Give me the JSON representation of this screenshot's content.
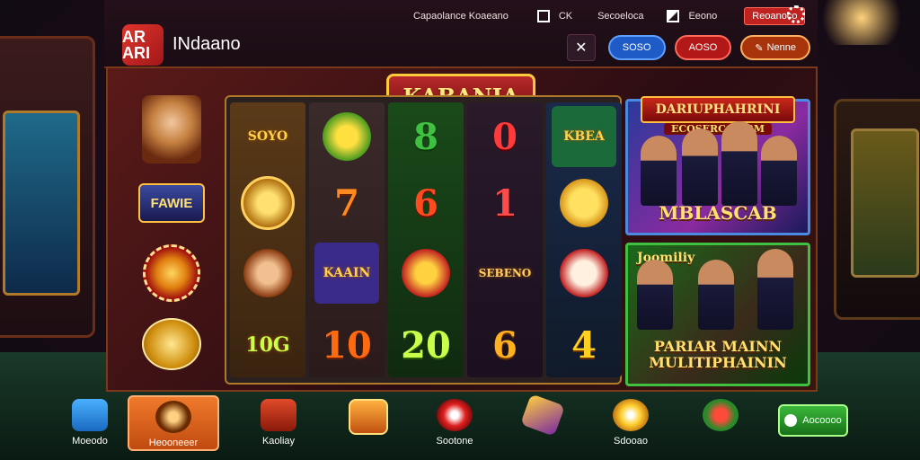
{
  "app": {
    "logo_text": "AR ARI",
    "name": "INdaano"
  },
  "top_links": [
    "Capaolance Koaeano",
    "CK",
    "Secoeloca",
    "Eeono",
    "Reoanoco"
  ],
  "actions": {
    "blue": "SOSO",
    "red": "AOSO",
    "orange": "Nenne"
  },
  "main": {
    "title": "KABANIA",
    "side_label": "FAWIE",
    "reels": [
      [
        "SOYO",
        "",
        "",
        "",
        "10G"
      ],
      [
        "",
        "7",
        "KAAIN",
        "",
        "10"
      ],
      [
        "8",
        "6",
        "",
        "20",
        ""
      ],
      [
        "0",
        "1",
        "",
        "SEBENO",
        "6"
      ],
      [
        "KBEA",
        "",
        "",
        "",
        "4"
      ]
    ],
    "promo1": {
      "ribbon": "DARIUPHAHRINI",
      "sub": "ECOSERCOMRM",
      "title": "MBLASCAB"
    },
    "promo2": {
      "top": "Joomiliy",
      "title": "PARIAR MAINN MULITIPHAININ"
    }
  },
  "bottom_nav": [
    {
      "label": "Moeodo",
      "icon": "s-logo-icon"
    },
    {
      "label": "Heooneeer",
      "icon": "compass-icon",
      "active": true
    },
    {
      "label": "Kaoliay",
      "icon": "bag-icon"
    },
    {
      "label": "",
      "icon": "cards-icon"
    },
    {
      "label": "Sootone",
      "icon": "heart-icon"
    },
    {
      "label": "",
      "icon": "gem-icon"
    },
    {
      "label": "Sdooao",
      "icon": "mascot-icon"
    },
    {
      "label": "",
      "icon": "emblem-icon"
    }
  ],
  "green_button": "Aocoooo"
}
